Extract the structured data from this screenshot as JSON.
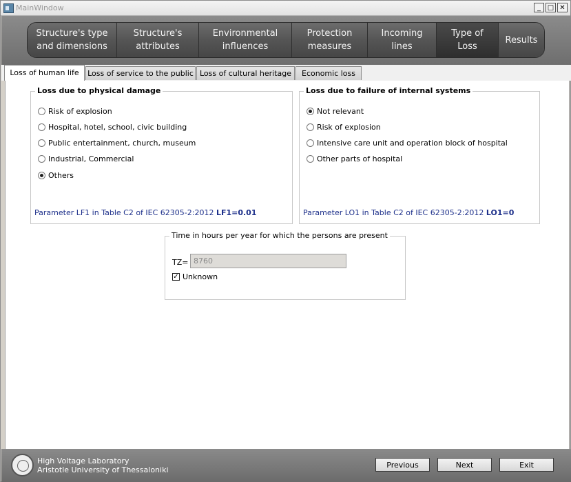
{
  "window": {
    "title": "MainWindow",
    "min": "_",
    "max": "□",
    "close": "✕"
  },
  "nav": {
    "items": [
      {
        "line1": "Structure's type",
        "line2": "and dimensions"
      },
      {
        "line1": "Structure's",
        "line2": "attributes"
      },
      {
        "line1": "Environmental",
        "line2": "influences"
      },
      {
        "line1": "Protection",
        "line2": "measures"
      },
      {
        "line1": "Incoming",
        "line2": "lines"
      },
      {
        "line1": "Type of",
        "line2": "Loss"
      },
      {
        "line1": "Results",
        "line2": ""
      }
    ]
  },
  "tabs": [
    "Loss of human life",
    "Loss of service to the public",
    "Loss of cultural heritage",
    "Economic loss"
  ],
  "physical": {
    "title": "Loss due to physical damage",
    "options": [
      "Risk of explosion",
      "Hospital, hotel, school, civic building",
      "Public entertainment, church, museum",
      "Industrial, Commercial",
      "Others"
    ],
    "param_text": "Parameter LF1 in Table C2 of IEC 62305-2:2012 ",
    "param_value": "LF1=0.01"
  },
  "internal": {
    "title": "Loss due to failure of internal systems",
    "options": [
      "Not relevant",
      "Risk of explosion",
      "Intensive care unit and operation block of hospital",
      "Other parts of hospital"
    ],
    "param_text": "Parameter LO1 in Table C2 of IEC 62305-2:2012 ",
    "param_value": "LO1=0"
  },
  "time": {
    "title": "Time in hours per year for which the persons are present",
    "tz_label": "TZ=",
    "tz_value": "8760",
    "unknown_label": "Unknown",
    "check_mark": "✓"
  },
  "footer": {
    "line1": "High Voltage Laboratory",
    "line2": "Aristotle University of Thessaloniki",
    "previous": "Previous",
    "next": "Next",
    "exit": "Exit"
  }
}
